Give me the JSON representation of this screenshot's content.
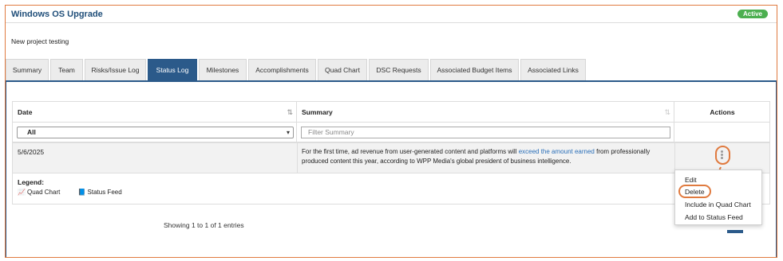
{
  "project": {
    "title": "Windows OS Upgrade",
    "status": "Active",
    "description": "New project testing"
  },
  "tabs": [
    {
      "label": "Summary"
    },
    {
      "label": "Team"
    },
    {
      "label": "Risks/Issue Log"
    },
    {
      "label": "Status Log"
    },
    {
      "label": "Milestones"
    },
    {
      "label": "Accomplishments"
    },
    {
      "label": "Quad Chart"
    },
    {
      "label": "DSC Requests"
    },
    {
      "label": "Associated Budget Items"
    },
    {
      "label": "Associated Links"
    }
  ],
  "active_tab": "Status Log",
  "table": {
    "headers": {
      "date": "Date",
      "summary": "Summary",
      "actions": "Actions"
    },
    "filters": {
      "date_selected": "All",
      "summary_placeholder": "Filter Summary"
    },
    "rows": [
      {
        "date": "5/6/2025",
        "summary_before": "For the first time, ad revenue from user-generated content and platforms will ",
        "summary_link": "exceed the amount earned",
        "summary_after": " from professionally produced content this year, according to WPP Media's global president of business intelligence."
      }
    ]
  },
  "legend": {
    "title": "Legend:",
    "items": [
      "Quad Chart",
      "Status Feed"
    ]
  },
  "footer": {
    "showing": "Showing 1 to 1 of 1 entries"
  },
  "actions_menu": {
    "items": [
      "Edit",
      "Delete",
      "Include in Quad Chart",
      "Add to Status Feed"
    ]
  },
  "colors": {
    "accent": "#2b5a8a",
    "annotation": "#e07a3f",
    "active_badge": "#4caf50",
    "link": "#2a6fb8"
  },
  "icons": {
    "sort": "sort-icon",
    "actions": "kebab-icon",
    "quad_chart": "chart-icon",
    "status_feed": "book-icon"
  }
}
